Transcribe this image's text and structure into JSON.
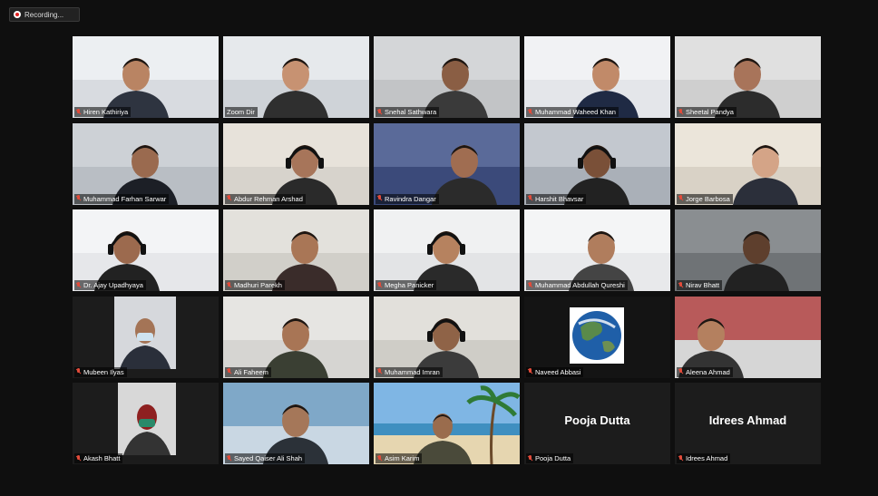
{
  "recording": {
    "label": "Recording..."
  },
  "participants": [
    {
      "name": "Hiren Kathiriya",
      "muted": true
    },
    {
      "name": "Zoom Dir",
      "muted": false,
      "active": true
    },
    {
      "name": "Snehal Sathwara",
      "muted": true
    },
    {
      "name": "Muhammad Waheed Khan",
      "muted": true
    },
    {
      "name": "Sheetal Pandya",
      "muted": true
    },
    {
      "name": "Muhammad Farhan Sarwar",
      "muted": true
    },
    {
      "name": "Abdur Rehman Arshad",
      "muted": true
    },
    {
      "name": "Ravindra Dangar",
      "muted": true
    },
    {
      "name": "Harshit Bhavsar",
      "muted": true
    },
    {
      "name": "Jorge Barbosa",
      "muted": true
    },
    {
      "name": "Dr. Ajay Upadhyaya",
      "muted": true
    },
    {
      "name": "Madhuri Parekh",
      "muted": true
    },
    {
      "name": "Megha Panicker",
      "muted": true
    },
    {
      "name": "Muhammad Abdullah Qureshi",
      "muted": true
    },
    {
      "name": "Nirav Bhatt",
      "muted": true
    },
    {
      "name": "Mubeen Ilyas",
      "muted": true
    },
    {
      "name": "Ali Faheem",
      "muted": true
    },
    {
      "name": "Muhammad Imran",
      "muted": true
    },
    {
      "name": "Naveed Abbasi",
      "muted": true
    },
    {
      "name": "Aleena Ahmad",
      "muted": true
    },
    {
      "name": "Akash Bhatt",
      "muted": true
    },
    {
      "name": "Sayed Qaiser Ali Shah",
      "muted": true
    },
    {
      "name": "Asim Karim",
      "muted": true
    },
    {
      "name": "Pooja Dutta",
      "muted": true,
      "video_off": true
    },
    {
      "name": "Idrees Ahmad",
      "muted": true,
      "video_off": true
    }
  ],
  "colors": {
    "active_border": "#b8e04a",
    "muted_icon": "#e24b3a"
  }
}
